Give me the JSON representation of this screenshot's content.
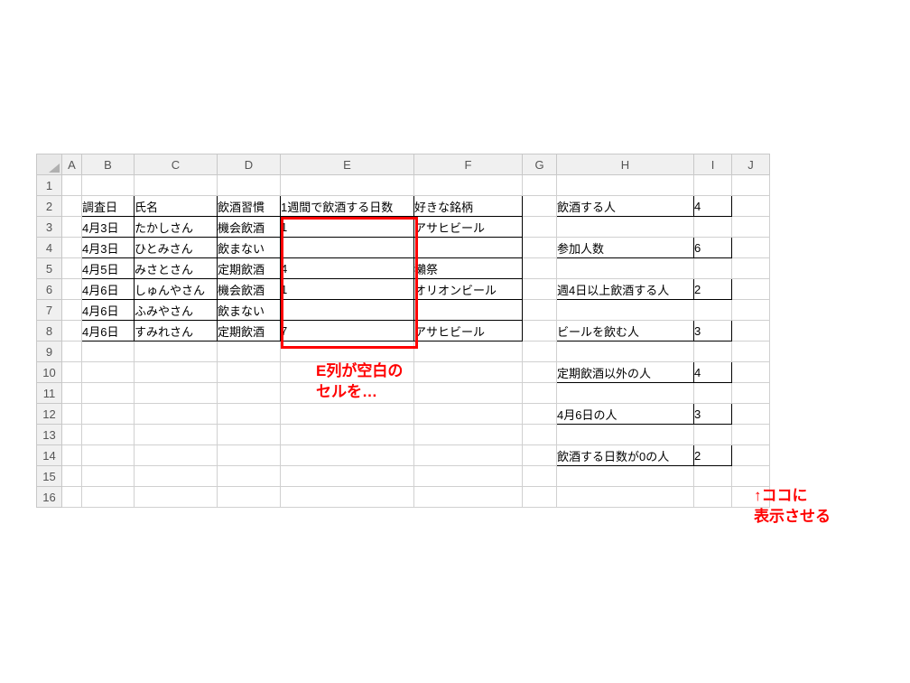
{
  "columns": [
    "A",
    "B",
    "C",
    "D",
    "E",
    "F",
    "G",
    "H",
    "I",
    "J"
  ],
  "rowHeaders": [
    "1",
    "2",
    "3",
    "4",
    "5",
    "6",
    "7",
    "8",
    "9",
    "10",
    "11",
    "12",
    "13",
    "14",
    "15",
    "16"
  ],
  "mainHeader": {
    "B": "調査日",
    "C": "氏名",
    "D": "飲酒習慣",
    "E": "1週間で飲酒する日数",
    "F": "好きな銘柄"
  },
  "mainRows": [
    {
      "B": "4月3日",
      "C": "たかしさん",
      "D": "機会飲酒",
      "E": "1",
      "F": "アサヒビール"
    },
    {
      "B": "4月3日",
      "C": "ひとみさん",
      "D": "飲まない",
      "E": "",
      "F": ""
    },
    {
      "B": "4月5日",
      "C": "みさとさん",
      "D": "定期飲酒",
      "E": "4",
      "F": "獺祭"
    },
    {
      "B": "4月6日",
      "C": "しゅんやさん",
      "D": "機会飲酒",
      "E": "1",
      "F": "オリオンビール"
    },
    {
      "B": "4月6日",
      "C": "ふみやさん",
      "D": "飲まない",
      "E": "",
      "F": ""
    },
    {
      "B": "4月6日",
      "C": "すみれさん",
      "D": "定期飲酒",
      "E": "7",
      "F": "アサヒビール"
    }
  ],
  "side": [
    {
      "row": 2,
      "label": "飲酒する人",
      "value": "4"
    },
    {
      "row": 4,
      "label": "参加人数",
      "value": "6"
    },
    {
      "row": 6,
      "label": "週4日以上飲酒する人",
      "value": "2"
    },
    {
      "row": 8,
      "label": "ビールを飲む人",
      "value": "3"
    },
    {
      "row": 10,
      "label": "定期飲酒以外の人",
      "value": "4"
    },
    {
      "row": 12,
      "label": "4月6日の人",
      "value": "3"
    },
    {
      "row": 14,
      "label": "飲酒する日数が0の人",
      "value": "2"
    }
  ],
  "annotations": {
    "center": "E列が空白の\nセルを…",
    "right": "↑ココに\n表示させる"
  }
}
